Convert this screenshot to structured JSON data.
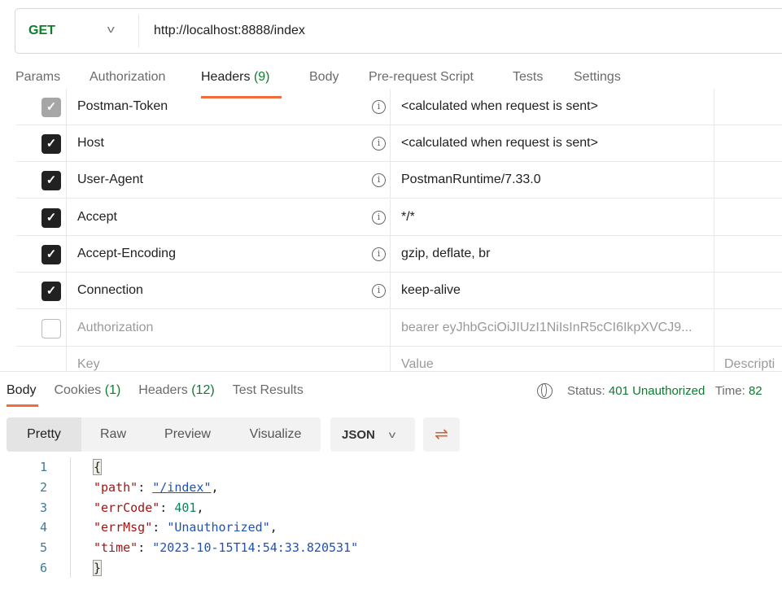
{
  "request": {
    "method": "GET",
    "url": "http://localhost:8888/index"
  },
  "tabs": [
    {
      "label": "Params"
    },
    {
      "label": "Authorization"
    },
    {
      "label": "Headers",
      "count": "(9)"
    },
    {
      "label": "Body"
    },
    {
      "label": "Pre-request Script"
    },
    {
      "label": "Tests"
    },
    {
      "label": "Settings"
    }
  ],
  "headers": [
    {
      "key": "Postman-Token",
      "value": "<calculated when request is sent>",
      "state": "disabled-checked"
    },
    {
      "key": "Host",
      "value": "<calculated when request is sent>",
      "state": "checked"
    },
    {
      "key": "User-Agent",
      "value": "PostmanRuntime/7.33.0",
      "state": "checked"
    },
    {
      "key": "Accept",
      "value": "*/*",
      "state": "checked"
    },
    {
      "key": "Accept-Encoding",
      "value": "gzip, deflate, br",
      "state": "checked"
    },
    {
      "key": "Connection",
      "value": "keep-alive",
      "state": "checked"
    },
    {
      "key": "Authorization",
      "value": "bearer eyJhbGciOiJIUzI1NiIsInR5cCI6IkpXVCJ9...",
      "state": "unchecked"
    }
  ],
  "new_row": {
    "key_placeholder": "Key",
    "value_placeholder": "Value",
    "description_placeholder": "Descripti"
  },
  "response": {
    "tabs": [
      {
        "label": "Body"
      },
      {
        "label": "Cookies",
        "count": "(1)"
      },
      {
        "label": "Headers",
        "count": "(12)"
      },
      {
        "label": "Test Results"
      }
    ],
    "status_label": "Status:",
    "status_value": "401 Unauthorized",
    "time_label": "Time:",
    "time_value": "82",
    "views": [
      "Pretty",
      "Raw",
      "Preview",
      "Visualize"
    ],
    "format": "JSON",
    "body_lines": [
      {
        "n": "1"
      },
      {
        "n": "2",
        "k": "\"path\"",
        "v": "\"/index\""
      },
      {
        "n": "3",
        "k": "\"errCode\"",
        "v": "401"
      },
      {
        "n": "4",
        "k": "\"errMsg\"",
        "v": "\"Unauthorized\""
      },
      {
        "n": "5",
        "k": "\"time\"",
        "v": "\"2023-10-15T14:54:33.820531\""
      },
      {
        "n": "6"
      }
    ],
    "open_brace": "{",
    "close_brace": "}"
  },
  "colors": {
    "accent": "#f26b3a",
    "success": "#0f7b2e"
  }
}
